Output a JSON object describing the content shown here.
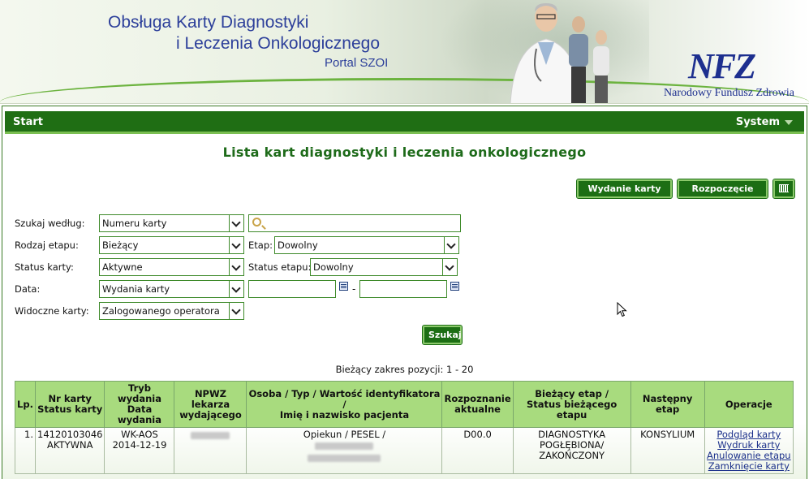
{
  "banner": {
    "title_line1": "Obsługa Karty Diagnostyki",
    "title_line2": "i Leczenia Onkologicznego",
    "portal": "Portal SZOI",
    "logo": "NFZ",
    "org": "Narodowy Fundusz Zdrowia"
  },
  "nav": {
    "start": "Start",
    "system": "System"
  },
  "page_title": "Lista kart diagnostyki i leczenia onkologicznego",
  "toolbar": {
    "wydanie": "Wydanie karty DiLO",
    "rozpoczecie": "Rozpoczęcie etapu",
    "barcode_icon": "barcode-icon"
  },
  "filters": {
    "szukaj_label": "Szukaj według:",
    "szukaj_value": "Numeru karty",
    "rodzaj_label": "Rodzaj etapu:",
    "rodzaj_value": "Bieżący",
    "etap_label": "Etap:",
    "etap_value": "Dowolny",
    "status_label": "Status karty:",
    "status_value": "Aktywne",
    "status_etapu_label": "Status etapu:",
    "status_etapu_value": "Dowolny",
    "data_label": "Data:",
    "data_value": "Wydania karty",
    "date_separator": "-",
    "widoczne_label": "Widoczne karty:",
    "widoczne_value": "Zalogowanego operatora",
    "search_button": "Szukaj"
  },
  "range_text": "Bieżący zakres pozycji: 1 - 20",
  "table": {
    "headers": [
      [
        "Lp."
      ],
      [
        "Nr karty",
        "Status karty"
      ],
      [
        "Tryb wydania",
        "Data wydania"
      ],
      [
        "NPWZ lekarza",
        "wydającego"
      ],
      [
        "Osoba / Typ / Wartość identyfikatora /",
        "Imię i nazwisko pacjenta"
      ],
      [
        "Rozpoznanie",
        "aktualne"
      ],
      [
        "Bieżący etap /",
        "Status bieżącego etapu"
      ],
      [
        "Następny etap"
      ],
      [
        "Operacje"
      ]
    ],
    "rows": [
      {
        "lp": "1.",
        "nr": "14120103046",
        "status": "AKTYWNA",
        "tryb": "WK-AOS",
        "data": "2014-12-19",
        "osoba": "Opiekun / PESEL /",
        "rozpoznanie": "D00.0",
        "etap1": "DIAGNOSTYKA",
        "etap2": "POGŁĘBIONA/",
        "etap3": "ZAKOŃCZONY",
        "nastepny": "KONSYLIUM",
        "ops": [
          "Podgląd karty",
          "Wydruk karty",
          "Anulowanie etapu",
          "Zamknięcie karty"
        ]
      }
    ]
  }
}
